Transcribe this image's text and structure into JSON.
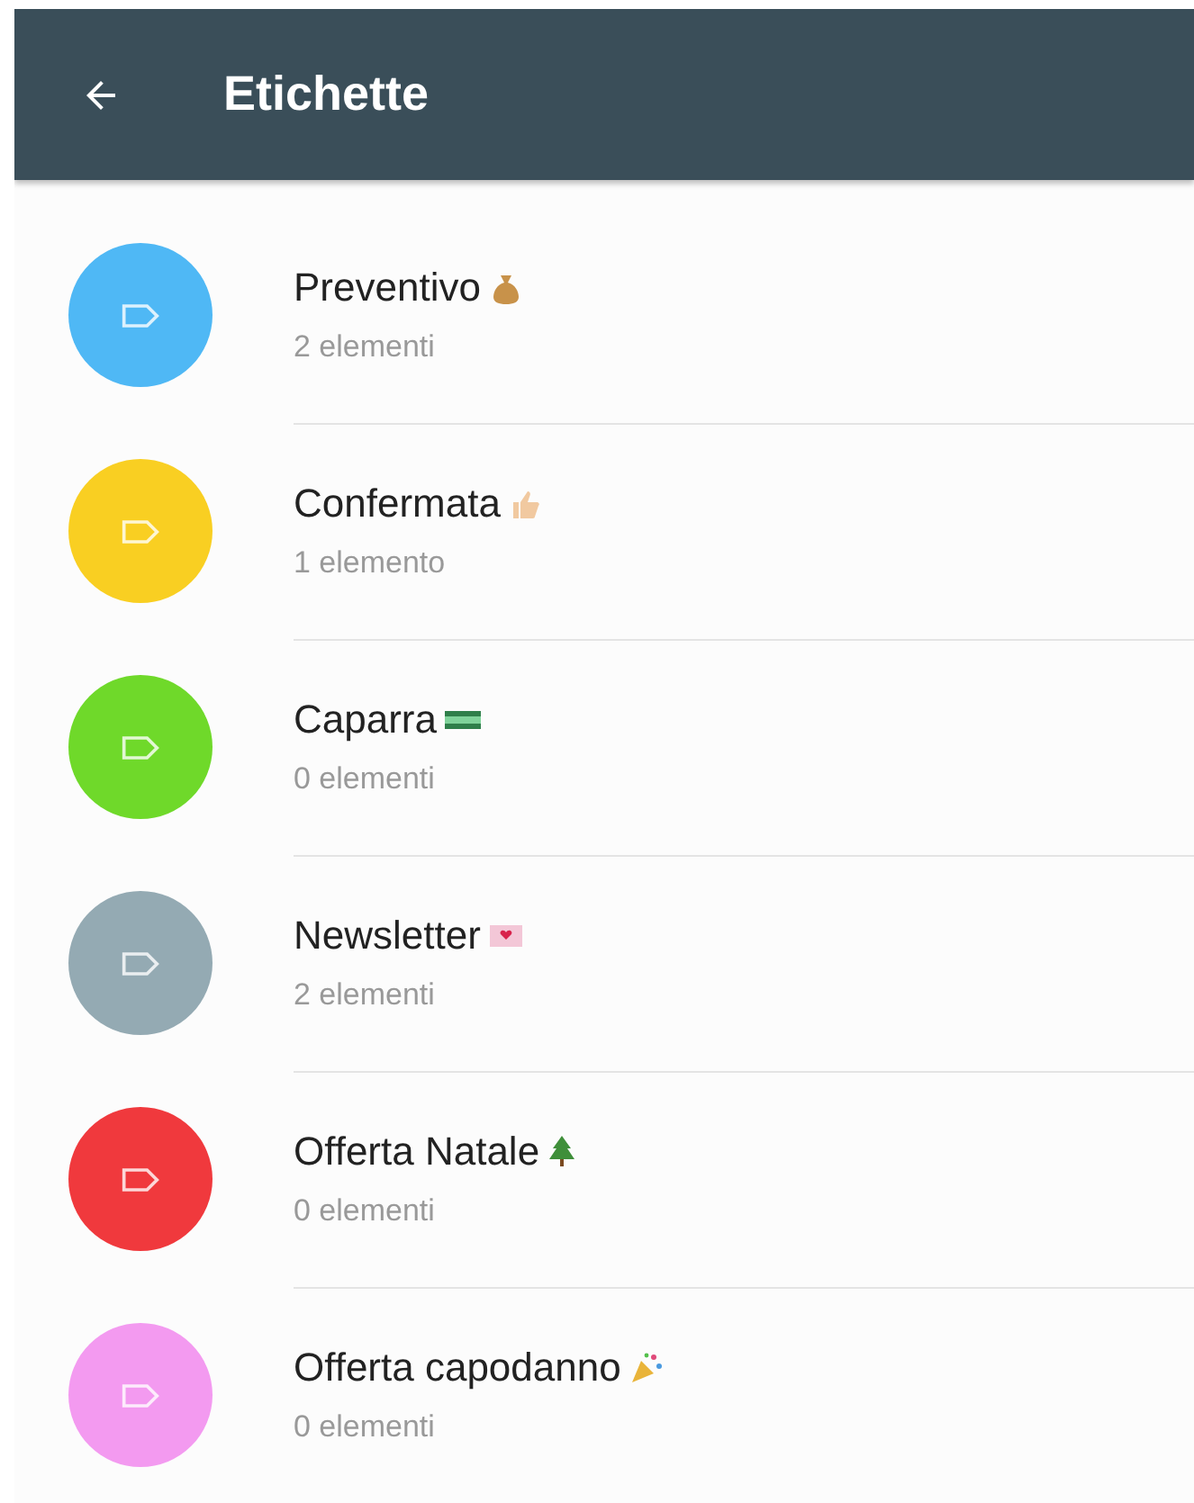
{
  "header": {
    "title": "Etichette"
  },
  "labels": [
    {
      "name": "Preventivo",
      "count": "2 elementi",
      "color": "#4fb8f5"
    },
    {
      "name": "Confermata",
      "count": "1 elemento",
      "color": "#f9cf22"
    },
    {
      "name": "Caparra",
      "count": "0 elementi",
      "color": "#6fd92a"
    },
    {
      "name": "Newsletter",
      "count": "2 elementi",
      "color": "#94aab3"
    },
    {
      "name": "Offerta Natale",
      "count": "0 elementi",
      "color": "#f0393d"
    },
    {
      "name": "Offerta capodanno",
      "count": "0 elementi",
      "color": "#f39af0"
    }
  ]
}
